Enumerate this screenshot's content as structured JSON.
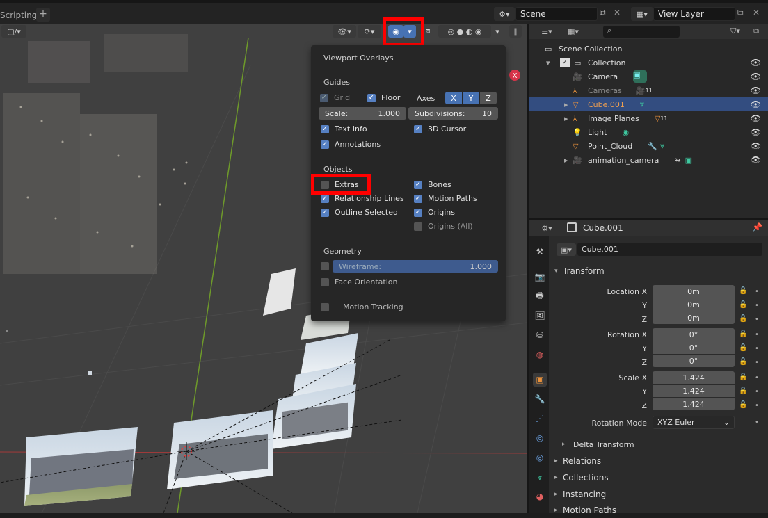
{
  "topbar": {
    "workspace_tab": "Scripting",
    "add_tab": "+",
    "scene_label": "Scene",
    "view_layer_label": "View Layer"
  },
  "overlay_popover": {
    "title": "Viewport Overlays",
    "guides": {
      "heading": "Guides",
      "grid": "Grid",
      "floor": "Floor",
      "axes": "Axes",
      "x": "X",
      "y": "Y",
      "z": "Z",
      "scale_label": "Scale:",
      "scale_value": "1.000",
      "subdiv_label": "Subdivisions:",
      "subdiv_value": "10",
      "text_info": "Text Info",
      "cursor_3d": "3D Cursor",
      "annotations": "Annotations"
    },
    "objects": {
      "heading": "Objects",
      "extras": "Extras",
      "bones": "Bones",
      "relationship_lines": "Relationship Lines",
      "motion_paths": "Motion Paths",
      "outline_selected": "Outline Selected",
      "origins": "Origins",
      "origins_all": "Origins (All)"
    },
    "geometry": {
      "heading": "Geometry",
      "wireframe_label": "Wireframe:",
      "wireframe_value": "1.000",
      "face_orientation": "Face Orientation",
      "motion_tracking": "Motion Tracking"
    }
  },
  "outliner": {
    "rows": [
      {
        "label": "Scene Collection"
      },
      {
        "label": "Collection"
      },
      {
        "label": "Camera"
      },
      {
        "label": "Cameras",
        "badge": "11"
      },
      {
        "label": "Cube.001"
      },
      {
        "label": "Image Planes",
        "badge": "11"
      },
      {
        "label": "Light"
      },
      {
        "label": "Point_Cloud"
      },
      {
        "label": "animation_camera"
      }
    ]
  },
  "properties": {
    "header_object": "Cube.001",
    "object_name": "Cube.001",
    "transform_heading": "Transform",
    "location_x_label": "Location X",
    "location_y_label": "Y",
    "location_z_label": "Z",
    "location": [
      "0m",
      "0m",
      "0m"
    ],
    "rotation_x_label": "Rotation X",
    "rotation_y_label": "Y",
    "rotation_z_label": "Z",
    "rotation": [
      "0°",
      "0°",
      "0°"
    ],
    "scale_x_label": "Scale X",
    "scale_y_label": "Y",
    "scale_z_label": "Z",
    "scale": [
      "1.424",
      "1.424",
      "1.424"
    ],
    "rotation_mode_label": "Rotation Mode",
    "rotation_mode_value": "XYZ Euler",
    "delta_transform": "Delta Transform",
    "panels": [
      "Relations",
      "Collections",
      "Instancing",
      "Motion Paths"
    ]
  },
  "colors": {
    "accent": "#4772b3",
    "selected_row": "#334d80",
    "highlight_box": "#ff0000",
    "object_orange": "#e8913c",
    "data_green": "#3ec8a0"
  }
}
